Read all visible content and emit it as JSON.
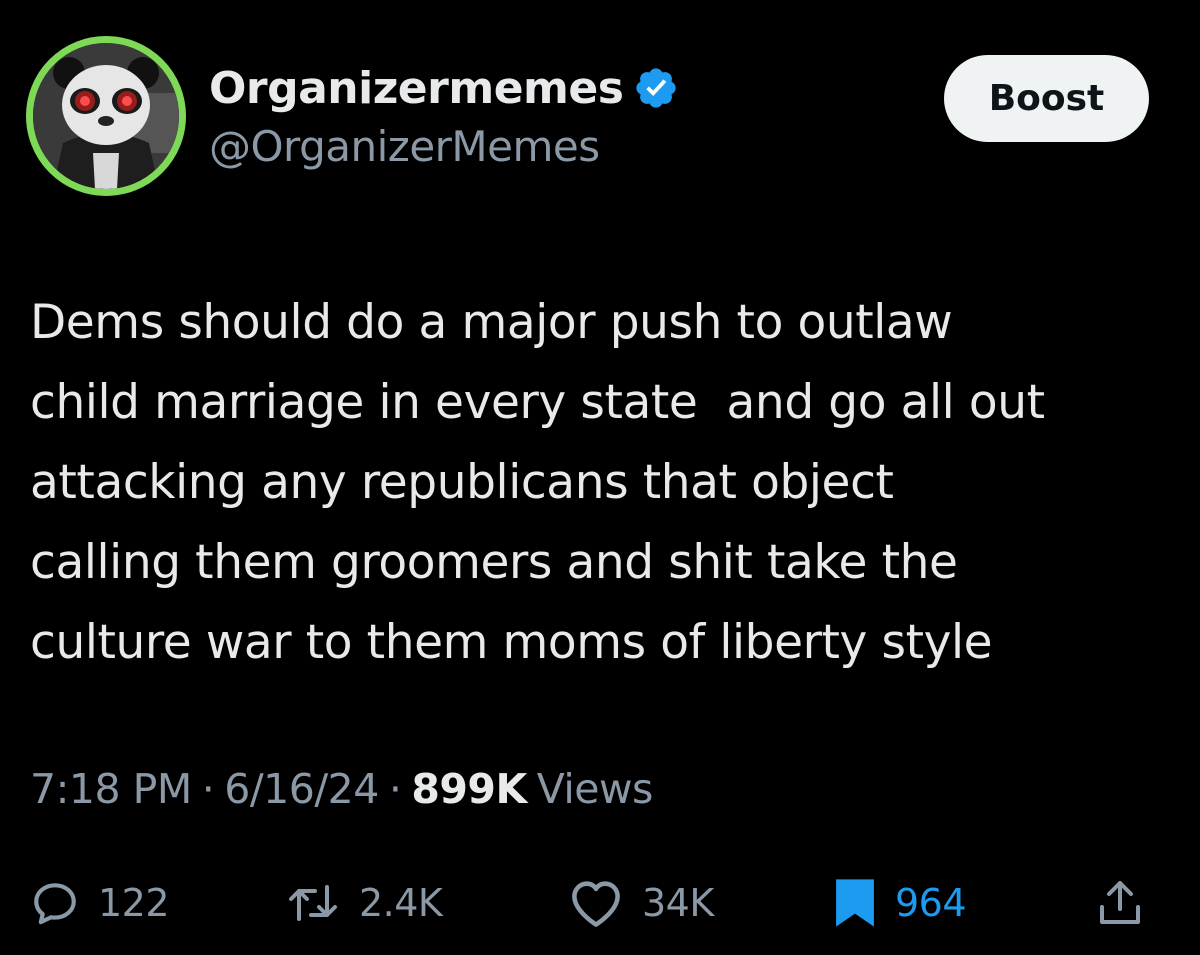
{
  "colors": {
    "background": "#000000",
    "text": "#e7e9ea",
    "muted": "#8b98a5",
    "accent": "#1d9bf0",
    "avatar_ring": "#7ed957"
  },
  "author": {
    "display_name": "Organizermemes",
    "handle": "@OrganizerMemes",
    "verified_icon": "verified-badge-icon",
    "avatar_icon": "panda-avatar"
  },
  "header": {
    "boost_label": "Boost"
  },
  "tweet": {
    "lines": [
      "Dems should do a major push to outlaw",
      "child marriage in every state  and go all out",
      "attacking any republicans that object",
      "calling them groomers and shit take the",
      "culture war to them moms of liberty style"
    ]
  },
  "meta": {
    "time": "7:18 PM",
    "separator": "·",
    "date": "6/16/24",
    "views_count": "899K",
    "views_label": "Views"
  },
  "actions": {
    "reply": {
      "icon": "reply-icon",
      "count": "122"
    },
    "retweet": {
      "icon": "retweet-icon",
      "count": "2.4K"
    },
    "like": {
      "icon": "heart-icon",
      "count": "34K"
    },
    "bookmark": {
      "icon": "bookmark-icon",
      "count": "964",
      "active": true
    },
    "share": {
      "icon": "share-icon"
    }
  }
}
